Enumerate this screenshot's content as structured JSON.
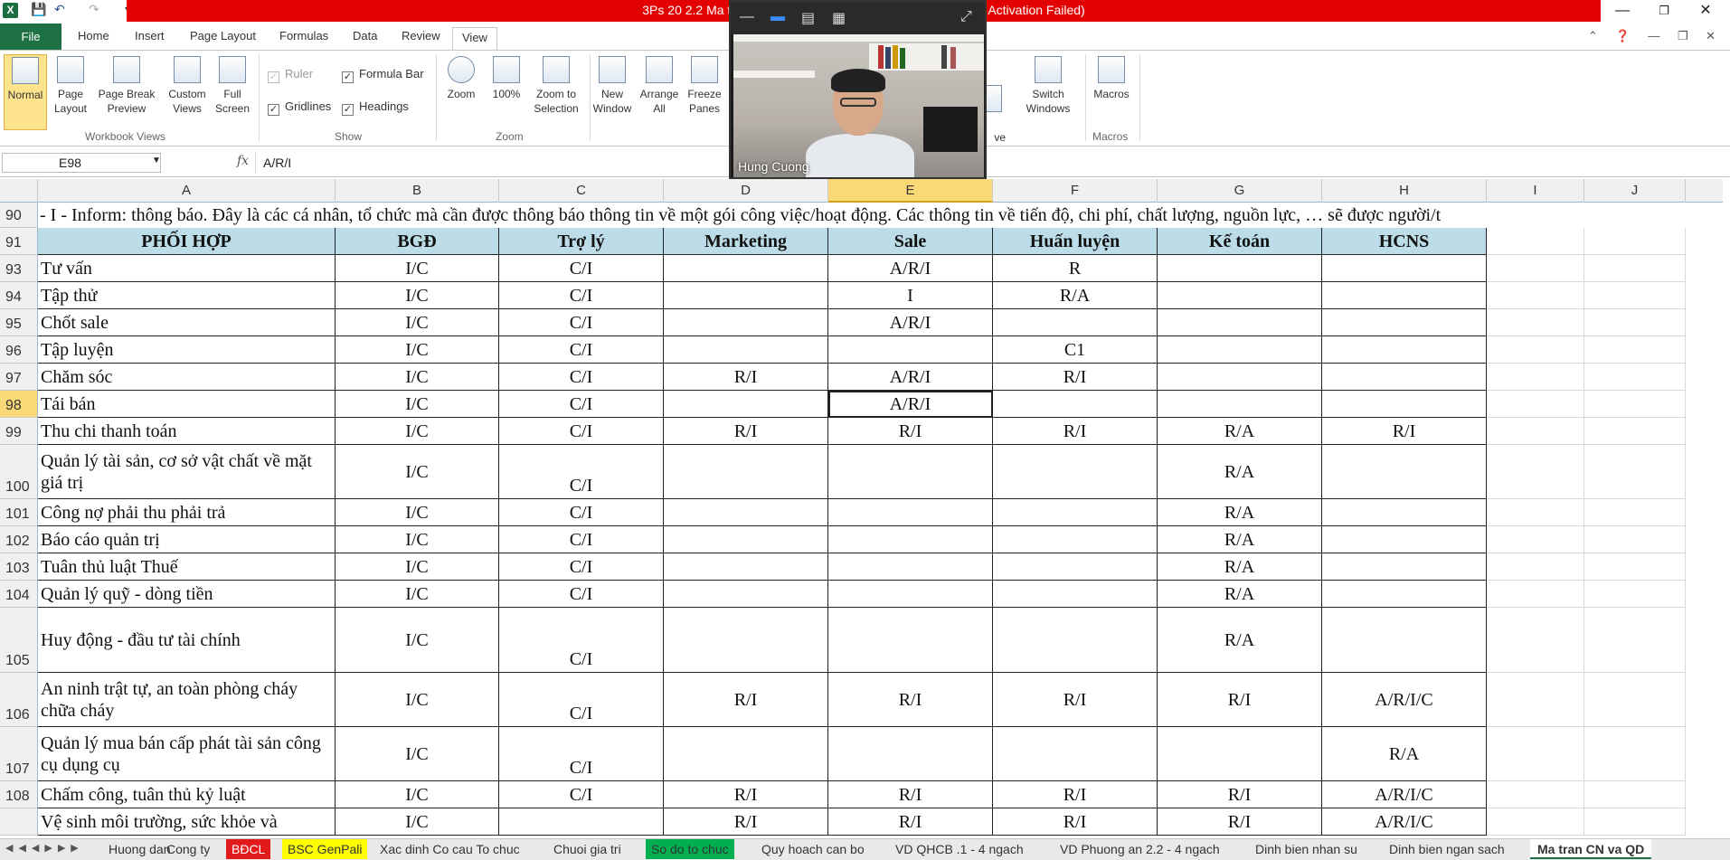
{
  "window": {
    "title": "3Ps 20 2.2 Ma tran chuc nang va … Microsoft Excel (Product Activation Failed)",
    "app_icon": "X"
  },
  "ribbon": {
    "tabs": [
      "File",
      "Home",
      "Insert",
      "Page Layout",
      "Formulas",
      "Data",
      "Review",
      "View"
    ],
    "active_tab": "View",
    "workbook_views": {
      "label": "Workbook Views",
      "normal": "Normal",
      "page_layout": "Page Layout",
      "page_break": "Page Break Preview",
      "custom_views": "Custom Views",
      "full_screen": "Full Screen"
    },
    "show": {
      "label": "Show",
      "ruler": "Ruler",
      "formula_bar": "Formula Bar",
      "gridlines": "Gridlines",
      "headings": "Headings"
    },
    "zoom": {
      "label": "Zoom",
      "zoom": "Zoom",
      "hundred": "100%",
      "zoom_selection": "Zoom to Selection"
    },
    "window_group": {
      "new_window": "New Window",
      "arrange_all": "Arrange All",
      "freeze_panes": "Freeze Panes",
      "save_workspace": "ve\nspace",
      "switch_windows": "Switch Windows"
    },
    "macros": {
      "label": "Macros",
      "macros": "Macros"
    }
  },
  "formula_bar": {
    "name_box": "E98",
    "fx": "fx",
    "formula": "A/R/I"
  },
  "columns": [
    "A",
    "B",
    "C",
    "D",
    "E",
    "F",
    "G",
    "H",
    "I",
    "J"
  ],
  "selected_column": "E",
  "inform_row": {
    "row": "90",
    "text": "- I - Inform: thông báo. Đây là các cá nhân, tổ chức mà cần được thông báo thông tin về một gói công việc/hoạt động. Các thông tin về tiến độ, chi phí, chất lượng, nguồn lực, … sẽ được người/t"
  },
  "header_row": {
    "row": "91",
    "cells": [
      "PHỐI HỢP",
      "BGĐ",
      "Trợ lý",
      "Marketing",
      "Sale",
      "Huấn luyện",
      "Kế toán",
      "HCNS"
    ]
  },
  "rows": [
    {
      "row": "93",
      "cells": [
        "Tư vấn",
        "I/C",
        "C/I",
        "",
        "A/R/I",
        "R",
        "",
        ""
      ]
    },
    {
      "row": "94",
      "cells": [
        "Tập thử",
        "I/C",
        "C/I",
        "",
        "I",
        "R/A",
        "",
        ""
      ]
    },
    {
      "row": "95",
      "cells": [
        "Chốt sale",
        "I/C",
        "C/I",
        "",
        "A/R/I",
        "",
        "",
        ""
      ]
    },
    {
      "row": "96",
      "cells": [
        "Tập luyện",
        "I/C",
        "C/I",
        "",
        "",
        "C1",
        "",
        ""
      ]
    },
    {
      "row": "97",
      "cells": [
        "Chăm sóc",
        "I/C",
        "C/I",
        "R/I",
        "A/R/I",
        "R/I",
        "",
        ""
      ]
    },
    {
      "row": "98",
      "cells": [
        "Tái bán",
        "I/C",
        "C/I",
        "",
        "A/R/I",
        "",
        "",
        ""
      ]
    },
    {
      "row": "99",
      "cells": [
        "Thu chi thanh toán",
        "I/C",
        "C/I",
        "R/I",
        "R/I",
        "R/I",
        "R/A",
        "R/I"
      ]
    },
    {
      "row": "100",
      "cells": [
        "Quản lý tài sản, cơ sở vật chất về mặt giá trị",
        "I/C",
        "C/I",
        "",
        "",
        "",
        "R/A",
        ""
      ]
    },
    {
      "row": "101",
      "cells": [
        "Công nợ phải thu phải trả",
        "I/C",
        "C/I",
        "",
        "",
        "",
        "R/A",
        ""
      ]
    },
    {
      "row": "102",
      "cells": [
        "Báo cáo quản trị",
        "I/C",
        "C/I",
        "",
        "",
        "",
        "R/A",
        ""
      ]
    },
    {
      "row": "103",
      "cells": [
        "Tuân thủ luật Thuế",
        "I/C",
        "C/I",
        "",
        "",
        "",
        "R/A",
        ""
      ]
    },
    {
      "row": "104",
      "cells": [
        "Quản lý quỹ - dòng tiền",
        "I/C",
        "C/I",
        "",
        "",
        "",
        "R/A",
        ""
      ]
    },
    {
      "row": "105",
      "cells": [
        "Huy động - đầu tư tài chính",
        "I/C",
        "C/I",
        "",
        "",
        "",
        "R/A",
        ""
      ]
    },
    {
      "row": "106",
      "cells": [
        "An ninh trật tự, an toàn phòng cháy chữa cháy",
        "I/C",
        "C/I",
        "R/I",
        "R/I",
        "R/I",
        "R/I",
        "A/R/I/C"
      ]
    },
    {
      "row": "107",
      "cells": [
        "Quản lý mua bán cấp phát tài sản công cụ dụng cụ",
        "I/C",
        "C/I",
        "",
        "",
        "",
        "",
        "R/A"
      ]
    },
    {
      "row": "108",
      "cells": [
        "Chấm công, tuân thủ kỷ luật",
        "I/C",
        "C/I",
        "R/I",
        "R/I",
        "R/I",
        "R/I",
        "A/R/I/C"
      ]
    },
    {
      "row": "",
      "cells": [
        "Vệ sinh môi trường, sức khỏe và",
        "I/C",
        "",
        "R/I",
        "R/I",
        "R/I",
        "R/I",
        "A/R/I/C"
      ]
    }
  ],
  "active_cell": {
    "row": "98",
    "col": "E"
  },
  "sheet_tabs": [
    "Huong dan",
    "Cong ty",
    "BĐCL",
    "BSC GenPali",
    "Xac dinh Co cau To chuc",
    "Chuoi gia tri",
    "So do to chuc",
    "Quy hoach can bo",
    "VD QHCB .1 - 4 ngach",
    "VD Phuong an 2.2 - 4 ngach",
    "Dinh bien nhan su",
    "Dinh bien ngan sach",
    "Ma tran CN va QD"
  ],
  "active_sheet": "Ma tran CN va QD",
  "video": {
    "participant": "Hung Cuong"
  },
  "colors": {
    "title_red": "#e30000",
    "file_tab_green": "#1e7145",
    "header_fill": "#bcdce8",
    "selection_header": "#f9d977"
  }
}
